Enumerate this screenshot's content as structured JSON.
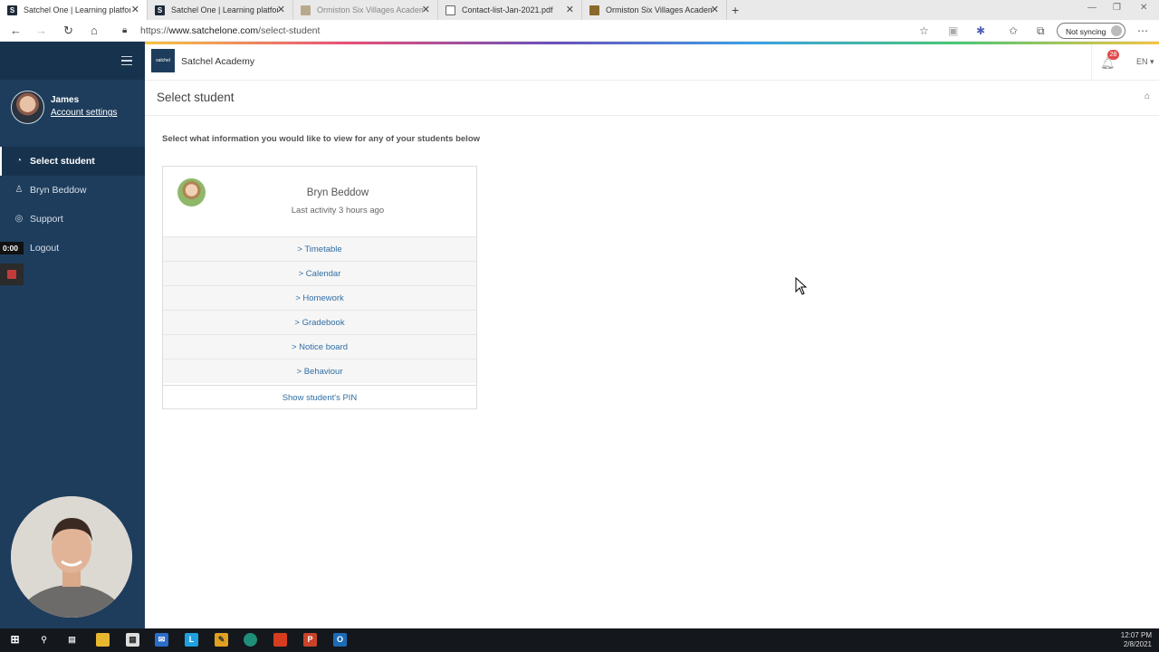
{
  "browser": {
    "tabs": [
      {
        "title": "Satchel One | Learning platform",
        "icon": "satchel-favicon",
        "active": true
      },
      {
        "title": "Satchel One | Learning platform",
        "icon": "satchel-favicon",
        "active": false
      },
      {
        "title": "Ormiston Six Villages Academy",
        "icon": "school-favicon",
        "active": false
      },
      {
        "title": "Contact-list-Jan-2021.pdf",
        "icon": "document-icon",
        "active": false
      },
      {
        "title": "Ormiston Six Villages Academy",
        "icon": "school-favicon",
        "active": false
      }
    ],
    "url_prefix": "https://",
    "url_domain": "www.satchelone.com",
    "url_path": "/select-student",
    "sync_label": "Not syncing"
  },
  "sidebar": {
    "user_name": "James",
    "account_settings": "Account settings",
    "items": [
      {
        "label": "Select student",
        "icon": "speedometer-icon",
        "active": true
      },
      {
        "label": "Bryn Beddow",
        "icon": "person-icon",
        "active": false
      },
      {
        "label": "Support",
        "icon": "lifebuoy-icon",
        "active": false
      },
      {
        "label": "Logout",
        "icon": "power-icon",
        "active": false
      }
    ],
    "recording_timer": "0:00"
  },
  "header": {
    "logo_text": "satchel",
    "school_name": "Satchel Academy",
    "notification_count": "28",
    "language": "EN ▾"
  },
  "page": {
    "title": "Select student",
    "instruction": "Select what information you would like to view for any of your students below"
  },
  "student_card": {
    "name": "Bryn Beddow",
    "last_activity": "Last activity 3 hours ago",
    "links": [
      "> Timetable",
      "> Calendar",
      "> Homework",
      "> Gradebook",
      "> Notice board",
      "> Behaviour"
    ],
    "pin_link": "Show student's PIN"
  },
  "taskbar": {
    "time": "12:07 PM",
    "date": "2/8/2021"
  },
  "colors": {
    "sidebar": "#1e3d5c",
    "link": "#2f6ea5",
    "badge": "#e24c4c"
  }
}
